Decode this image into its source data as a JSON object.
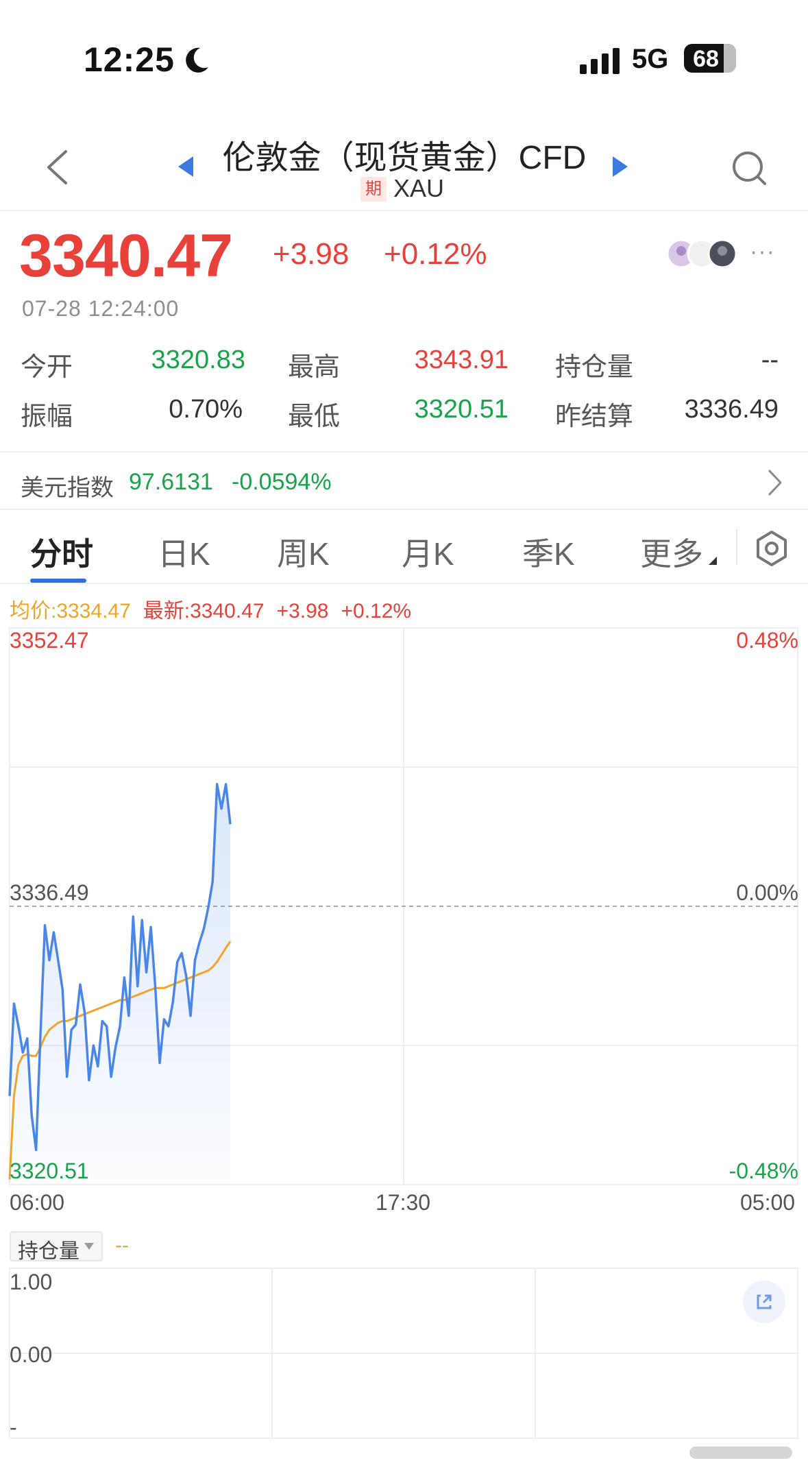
{
  "status_bar": {
    "time": "12:25",
    "network": "5G",
    "battery": "68"
  },
  "header": {
    "title": "伦敦金（现货黄金）CFD",
    "badge": "期",
    "symbol": "XAU"
  },
  "quote": {
    "price": "3340.47",
    "change": "+3.98",
    "change_pct": "+0.12%",
    "datetime": "07-28 12:24:00",
    "more": "···",
    "stats": [
      {
        "label": "今开",
        "value": "3320.83"
      },
      {
        "label": "最高",
        "value": "3343.91"
      },
      {
        "label": "持仓量",
        "value": "--"
      },
      {
        "label": "振幅",
        "value": "0.70%"
      },
      {
        "label": "最低",
        "value": "3320.51"
      },
      {
        "label": "昨结算",
        "value": "3336.49"
      }
    ]
  },
  "dxy": {
    "label": "美元指数",
    "value": "97.6131",
    "change": "-0.0594%"
  },
  "tabs": [
    "分时",
    "日K",
    "周K",
    "月K",
    "季K"
  ],
  "tab_more": "更多",
  "legend": {
    "avg": "均价:3334.47",
    "latest": "最新:3340.47",
    "change": "+3.98",
    "change_pct": "+0.12%"
  },
  "chart_data": {
    "type": "line",
    "series": [
      {
        "values": [
          3325.6,
          3330.9,
          3329.6,
          3328.1,
          3328.9,
          3324.5,
          3322.5,
          3329.2,
          3335.4,
          3333.4,
          3335.0,
          3333.4,
          3331.7,
          3326.7,
          3329.4,
          3329.7,
          3332.0,
          3330.4,
          3326.5,
          3328.5,
          3327.3,
          3329.9,
          3329.6,
          3326.7,
          3328.4,
          3329.6,
          3332.4,
          3330.2,
          3335.9,
          3331.9,
          3335.7,
          3332.7,
          3335.3,
          3331.9,
          3327.5,
          3330.0,
          3329.6,
          3331.0,
          3333.3,
          3333.8,
          3332.5,
          3330.2,
          3333.4,
          3334.4,
          3335.2,
          3336.4,
          3337.9,
          3343.5,
          3342.1,
          3343.5,
          3341.2
        ],
        "color": "#4a86e8"
      },
      {
        "values": [
          3320.8,
          3325.6,
          3327.4,
          3327.9,
          3328.0,
          3327.9,
          3327.9,
          3328.4,
          3329.0,
          3329.4,
          3329.6,
          3329.8,
          3329.9,
          3329.9,
          3330.0,
          3330.1,
          3330.2,
          3330.3,
          3330.4,
          3330.5,
          3330.6,
          3330.7,
          3330.8,
          3330.9,
          3331.0,
          3331.1,
          3331.1,
          3331.2,
          3331.3,
          3331.4,
          3331.5,
          3331.6,
          3331.7,
          3331.8,
          3331.8,
          3331.8,
          3331.9,
          3332.0,
          3332.1,
          3332.2,
          3332.3,
          3332.4,
          3332.5,
          3332.6,
          3332.7,
          3332.8,
          3333.0,
          3333.3,
          3333.7,
          3334.1,
          3334.47
        ],
        "color": "#f0a528"
      }
    ],
    "ylim": [
      3320.51,
      3352.47
    ],
    "x_ticks": [
      "06:00",
      "17:30",
      "05:00"
    ],
    "y_left": {
      "top": "3352.47",
      "mid": "3336.49",
      "bottom": "3320.51"
    },
    "y_right": {
      "top": "0.48%",
      "mid": "0.00%",
      "bottom": "-0.48%"
    },
    "x_progress": 0.28,
    "grid": true
  },
  "open_interest": {
    "label": "持仓量",
    "value": "--",
    "y_top": "1.00",
    "y_mid": "0.00",
    "y_bottom": "-"
  }
}
